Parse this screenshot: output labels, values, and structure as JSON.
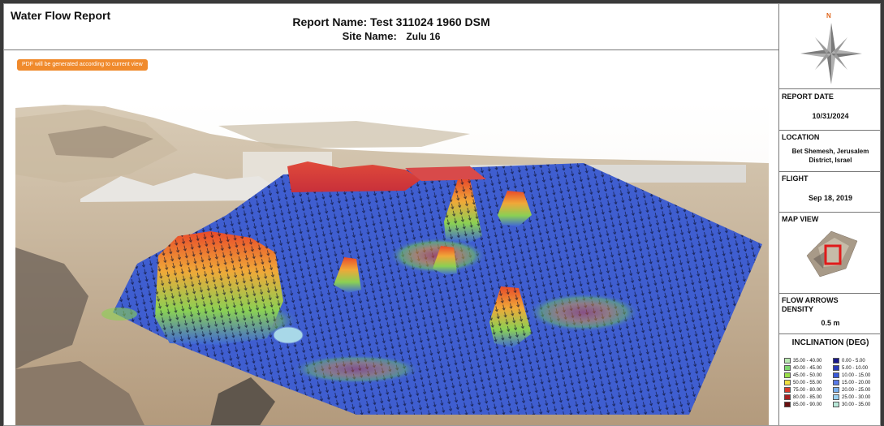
{
  "header": {
    "app_title": "Water Flow Report",
    "report_label": "Report Name:",
    "report_name": "Test 311024 1960 DSM",
    "site_label": "Site Name:",
    "site_name": "Zulu 16"
  },
  "pdf_notice": "PDF will be generated according to current view",
  "sidebar": {
    "compass_letter": "N",
    "report_date_label": "REPORT DATE",
    "report_date": "10/31/2024",
    "location_label": "LOCATION",
    "location_line1": "Bet Shemesh, Jerusalem",
    "location_line2": "District, Israel",
    "flight_label": "FLIGHT",
    "flight_date": "Sep 18, 2019",
    "map_view_label": "MAP VIEW",
    "arrows_label_line1": "FLOW ARROWS",
    "arrows_label_line2": "DENSITY",
    "arrows_density": "0.5 m",
    "inclination_title": "INCLINATION (DEG)"
  },
  "legend": {
    "left": [
      {
        "label": "35.00 - 40.00",
        "color": "#b8e8b0"
      },
      {
        "label": "40.00 - 45.00",
        "color": "#7ed66e"
      },
      {
        "label": "45.00 - 50.00",
        "color": "#9ae04a"
      },
      {
        "label": "50.00 - 55.00",
        "color": "#f0e040"
      },
      {
        "label": "75.00 - 80.00",
        "color": "#d83a2a"
      },
      {
        "label": "80.00 - 85.00",
        "color": "#a82020"
      },
      {
        "label": "85.00 - 90.00",
        "color": "#6a1010"
      }
    ],
    "right": [
      {
        "label": "0.00 - 5.00",
        "color": "#1a1a8a"
      },
      {
        "label": "5.00 - 10.00",
        "color": "#2a3ab8"
      },
      {
        "label": "10.00 - 15.00",
        "color": "#3a5ad8"
      },
      {
        "label": "15.00 - 20.00",
        "color": "#5a7ae8"
      },
      {
        "label": "20.00 - 25.00",
        "color": "#7ab0f0"
      },
      {
        "label": "25.00 - 30.00",
        "color": "#9ad0f0"
      },
      {
        "label": "30.00 - 35.00",
        "color": "#b8e8d8"
      }
    ]
  }
}
